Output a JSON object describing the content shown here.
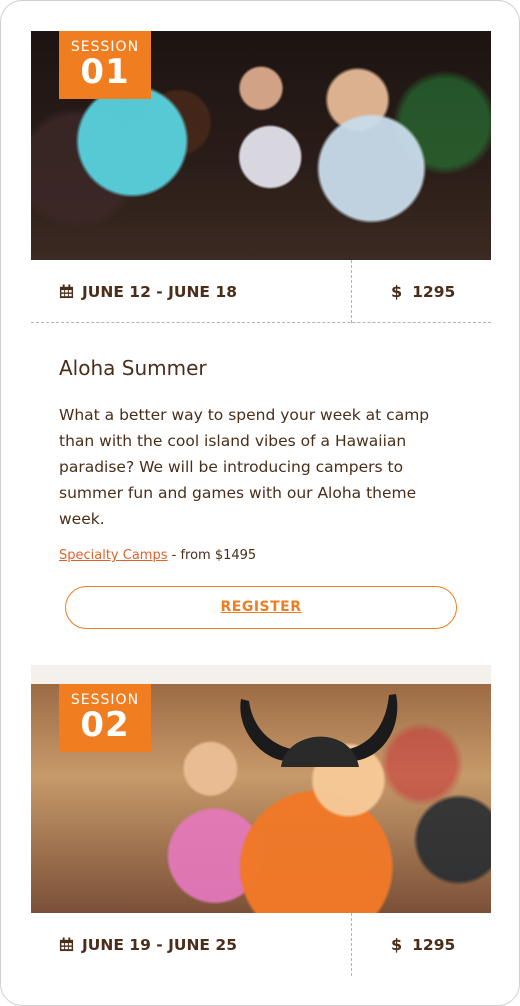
{
  "sessions": [
    {
      "badge_label": "SESSION",
      "badge_number": "01",
      "dates": "JUNE 12 - JUNE 18",
      "price": "1295",
      "title": "Aloha Summer",
      "description": "What a better way to spend your week at camp than with the cool island vibes of a Hawaiian paradise? We will be introducing campers to summer fun and games with our Aloha theme week.",
      "category_link": "Specialty Camps",
      "category_suffix": " - from $1495",
      "register_label": "REGISTER"
    },
    {
      "badge_label": "SESSION",
      "badge_number": "02",
      "dates": "JUNE 19 - JUNE 25",
      "price": "1295"
    }
  ],
  "colors": {
    "accent": "#f07d1f",
    "text": "#4a2e1a",
    "link": "#e0622a"
  },
  "icons": {
    "date": "calendar-icon",
    "price": "dollar-icon"
  }
}
